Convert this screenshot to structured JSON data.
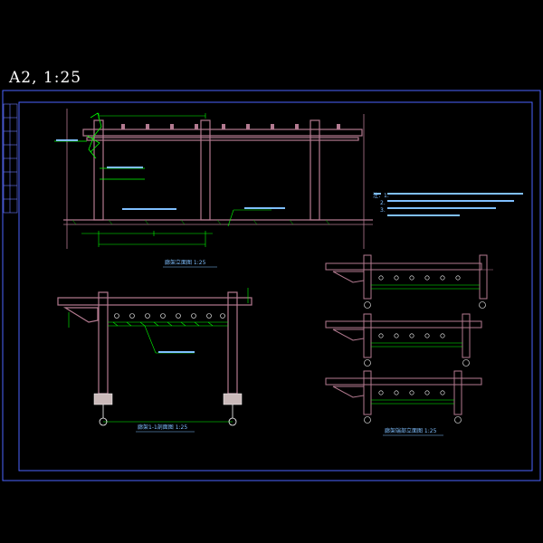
{
  "sheet": {
    "title": "A2,  1:25"
  },
  "drawing": {
    "background": "#000000",
    "frame_color": "#4b63ff",
    "structure_color": "#b37a90",
    "dimension_color": "#00ff00",
    "text_color": "#7fbfff",
    "axis_marker_color": "#ffffff"
  },
  "views": [
    {
      "id": "view-front-elevation",
      "caption": "廊架立面图 1:25"
    },
    {
      "id": "view-side-elevation",
      "caption": "廊架1-1剖面图 1:25"
    },
    {
      "id": "view-detail-elevations",
      "caption": "廊架端部立面图 1:25"
    }
  ],
  "notes": {
    "lines": [
      "注：1.",
      "2.",
      "3."
    ]
  }
}
